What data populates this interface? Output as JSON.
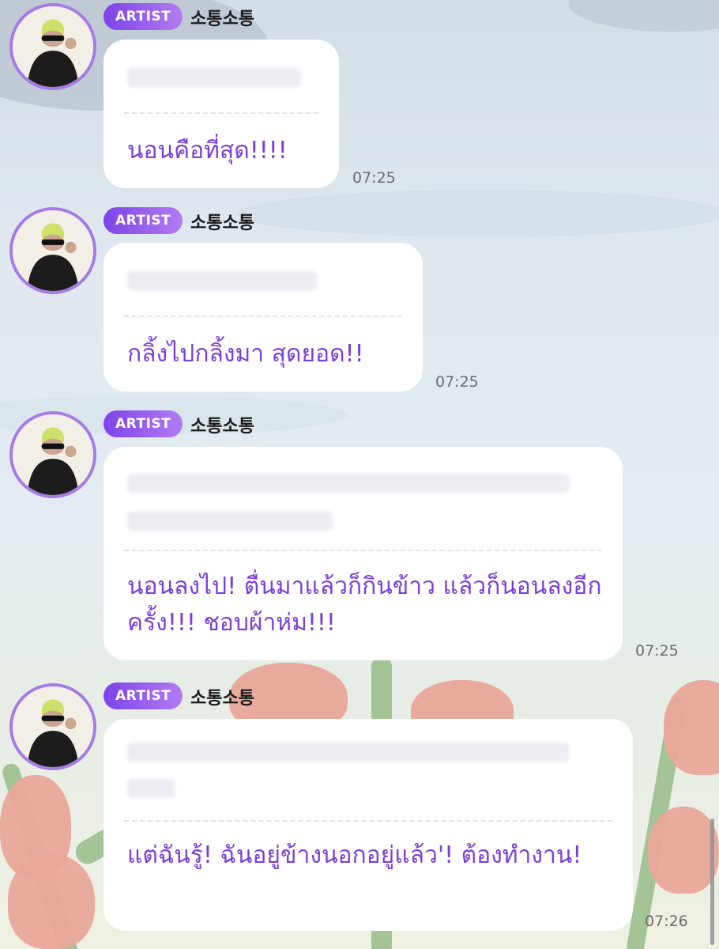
{
  "colors": {
    "accent": "#8a4fe9",
    "translation_text": "#7a3fd8",
    "bubble": "#ffffff",
    "timestamp": "#6d6d6d"
  },
  "messages": [
    {
      "badge": "ARTIST",
      "name": "소통소통",
      "avatar_icon": "artist-avatar",
      "translation": "นอนคือที่สุด!!!!",
      "time": "07:25"
    },
    {
      "badge": "ARTIST",
      "name": "소통소통",
      "avatar_icon": "artist-avatar",
      "translation": "กลิ้งไปกลิ้งมา สุดยอด!!",
      "time": "07:25"
    },
    {
      "badge": "ARTIST",
      "name": "소통소통",
      "avatar_icon": "artist-avatar",
      "translation": "นอนลงไป! ตื่นมาแล้วก็กินข้าว แล้วก็นอนลงอีกครั้ง!!! ชอบผ้าห่ม!!!",
      "time": "07:25"
    },
    {
      "badge": "ARTIST",
      "name": "소통소통",
      "avatar_icon": "artist-avatar",
      "translation": "แต่ฉันรู้! ฉันอยู่ข้างนอกอยู่แล้ว'! ต้องทำงาน!",
      "time": "07:26"
    }
  ]
}
